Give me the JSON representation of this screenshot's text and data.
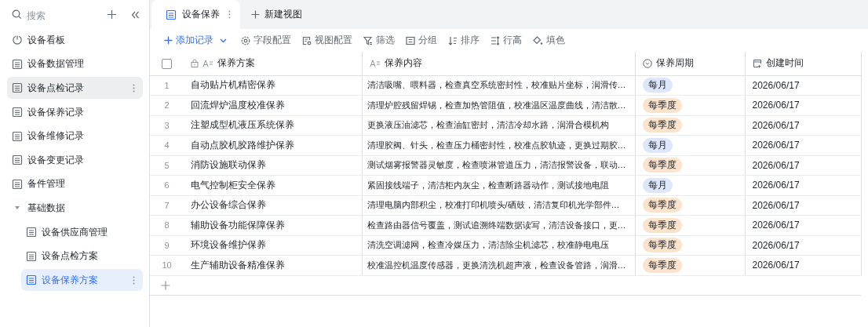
{
  "sidebar": {
    "search": {
      "placeholder": "搜索"
    },
    "items": [
      {
        "label": "设备看板",
        "kind": "dashboard",
        "selected": false,
        "hovered": false
      },
      {
        "label": "设备数据管理",
        "kind": "table",
        "selected": false,
        "hovered": false
      },
      {
        "label": "设备点检记录",
        "kind": "table",
        "selected": false,
        "hovered": true
      },
      {
        "label": "设备保养记录",
        "kind": "table",
        "selected": false,
        "hovered": false
      },
      {
        "label": "设备维修记录",
        "kind": "table",
        "selected": false,
        "hovered": false
      },
      {
        "label": "设备变更记录",
        "kind": "table",
        "selected": false,
        "hovered": false
      },
      {
        "label": "备件管理",
        "kind": "table",
        "selected": false,
        "hovered": false
      },
      {
        "label": "基础数据",
        "kind": "folder",
        "expanded": true,
        "children": [
          {
            "label": "设备供应商管理",
            "kind": "table",
            "selected": false,
            "hovered": false
          },
          {
            "label": "设备点检方案",
            "kind": "table",
            "selected": false,
            "hovered": false
          },
          {
            "label": "设备保养方案",
            "kind": "table",
            "selected": true,
            "hovered": true
          }
        ]
      }
    ]
  },
  "view_tabs": [
    {
      "label": "设备保养",
      "selected": true
    }
  ],
  "new_view": "新建视图",
  "toolbar": [
    "添加记录",
    "字段配置",
    "视图配置",
    "筛选",
    "分组",
    "排序",
    "行高",
    "填色"
  ],
  "table": {
    "select_all": {
      "checked": false
    },
    "columns": [
      "保养方案",
      "保养内容",
      "保养周期",
      "创建时间"
    ],
    "rows": [
      {
        "number": "1",
        "plan": "自动贴片机精密保养",
        "content": "清洁吸嘴、喂料器，检查真空系统密封性，校准贴片坐标，润滑传…",
        "cycle": {
          "label": "每月",
          "color": "#dde6fb"
        },
        "created": "2026/06/17"
      },
      {
        "number": "2",
        "plan": "回流焊炉温度校准保养",
        "content": "清理炉腔残留焊锡，检查加热管阻值，校准温区温度曲线，清洁散…",
        "cycle": {
          "label": "每季度",
          "color": "#fbe3cc"
        },
        "created": "2026/06/17"
      },
      {
        "number": "3",
        "plan": "注塑成型机液压系统保养",
        "content": "更换液压油滤芯，检查油缸密封，清洁冷却水路，润滑合模机构",
        "cycle": {
          "label": "每季度",
          "color": "#fbe3cc"
        },
        "created": "2026/06/17"
      },
      {
        "number": "4",
        "plan": "自动点胶机胶路维护保养",
        "content": "清理胶阀、针头，检查压力桶密封性，校准点胶轨迹，更换过期胶…",
        "cycle": {
          "label": "每月",
          "color": "#dde6fb"
        },
        "created": "2026/06/17"
      },
      {
        "number": "5",
        "plan": "消防设施联动保养",
        "content": "测试烟雾报警器灵敏度，检查喷淋管道压力，清洁报警设备，联动…",
        "cycle": {
          "label": "每季度",
          "color": "#fbe3cc"
        },
        "created": "2026/06/17"
      },
      {
        "number": "6",
        "plan": "电气控制柜安全保养",
        "content": "紧固接线端子，清洁柜内灰尘，检查断路器动作，测试接地电阻",
        "cycle": {
          "label": "每月",
          "color": "#dde6fb"
        },
        "created": "2026/06/17"
      },
      {
        "number": "7",
        "plan": "办公设备综合保养",
        "content": "清理电脑内部积尘，校准打印机喷头/硒鼓，清洁复印机光学部件…",
        "cycle": {
          "label": "每季度",
          "color": "#fbe3cc"
        },
        "created": "2026/06/17"
      },
      {
        "number": "8",
        "plan": "辅助设备功能保障保养",
        "content": "检查路由器信号覆盖，测试追溯终端数据读写，清洁设备接口，更…",
        "cycle": {
          "label": "每季度",
          "color": "#fbe3cc"
        },
        "created": "2026/06/17"
      },
      {
        "number": "9",
        "plan": "环境设备维护保养",
        "content": "清洗空调滤网，检查冷媒压力，清洁除尘机滤芯，校准静电电压",
        "cycle": {
          "label": "每季度",
          "color": "#fbe3cc"
        },
        "created": "2026/06/17"
      },
      {
        "number": "10",
        "plan": "生产辅助设备精准保养",
        "content": "校准温控机温度传感器，更换清洗机超声液，检查设备管路，润滑…",
        "cycle": {
          "label": "每季度",
          "color": "#fbe3cc"
        },
        "created": "2026/06/17"
      }
    ]
  }
}
